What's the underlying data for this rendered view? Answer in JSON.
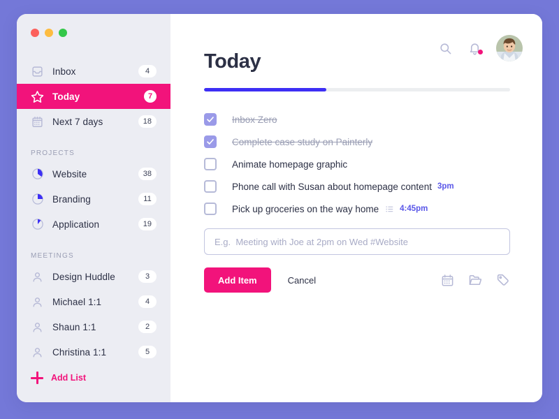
{
  "theme": {
    "page_background": "#7478d8",
    "accent_pink": "#f2137b",
    "accent_blue": "#3d2ff5",
    "time_blue": "#5a57e8",
    "sidebar_background": "#ecedf3",
    "text_dark": "#2c3045",
    "text_muted": "#9a9eb4",
    "checkbox_checked": "#9a9ae8"
  },
  "window": {
    "traffic_lights": [
      "close-red",
      "minimize-yellow",
      "maximize-green"
    ]
  },
  "sidebar": {
    "nav": [
      {
        "id": "inbox",
        "label": "Inbox",
        "badge": "4",
        "icon": "inbox-icon",
        "active": false
      },
      {
        "id": "today",
        "label": "Today",
        "badge": "7",
        "icon": "star-icon",
        "active": true
      },
      {
        "id": "next-7-days",
        "label": "Next 7 days",
        "badge": "18",
        "icon": "calendar-icon",
        "active": false
      }
    ],
    "projects_section_title": "PROJECTS",
    "projects": [
      {
        "id": "website",
        "label": "Website",
        "badge": "38",
        "icon": "pie-progress-icon",
        "progress": 25
      },
      {
        "id": "branding",
        "label": "Branding",
        "badge": "11",
        "icon": "pie-progress-icon",
        "progress": 25
      },
      {
        "id": "application",
        "label": "Application",
        "badge": "19",
        "icon": "pie-progress-icon",
        "progress": 15
      }
    ],
    "meetings_section_title": "MEETINGS",
    "meetings": [
      {
        "id": "design-huddle",
        "label": "Design Huddle",
        "badge": "3",
        "icon": "person-icon"
      },
      {
        "id": "michael-1-1",
        "label": "Michael 1:1",
        "badge": "4",
        "icon": "person-icon"
      },
      {
        "id": "shaun-1-1",
        "label": "Shaun 1:1",
        "badge": "2",
        "icon": "person-icon"
      },
      {
        "id": "christina-1-1",
        "label": "Christina 1:1",
        "badge": "5",
        "icon": "person-icon"
      }
    ],
    "add_list_label": "Add List",
    "add_list_icon": "plus-icon"
  },
  "header": {
    "search_icon": "search-icon",
    "notifications_icon": "bell-icon",
    "notifications_has_unread": true,
    "avatar": "user-avatar"
  },
  "main": {
    "title": "Today",
    "progress_percent": 40,
    "tasks": [
      {
        "id": "task-1",
        "label": "Inbox Zero",
        "done": true,
        "time": "",
        "has_list_icon": false
      },
      {
        "id": "task-2",
        "label": "Complete case study on Painterly",
        "done": true,
        "time": "",
        "has_list_icon": false
      },
      {
        "id": "task-3",
        "label": "Animate homepage graphic",
        "done": false,
        "time": "",
        "has_list_icon": false
      },
      {
        "id": "task-4",
        "label": "Phone call with Susan about homepage content",
        "done": false,
        "time": "3pm",
        "has_list_icon": false
      },
      {
        "id": "task-5",
        "label": "Pick up groceries on the way home",
        "done": false,
        "time": "4:45pm",
        "has_list_icon": true
      }
    ],
    "composer": {
      "placeholder": "E.g.  Meeting with Joe at 2pm on Wed #Website",
      "value": "",
      "add_label": "Add Item",
      "cancel_label": "Cancel",
      "tools": [
        "calendar-icon",
        "folder-icon",
        "tag-icon"
      ]
    }
  }
}
